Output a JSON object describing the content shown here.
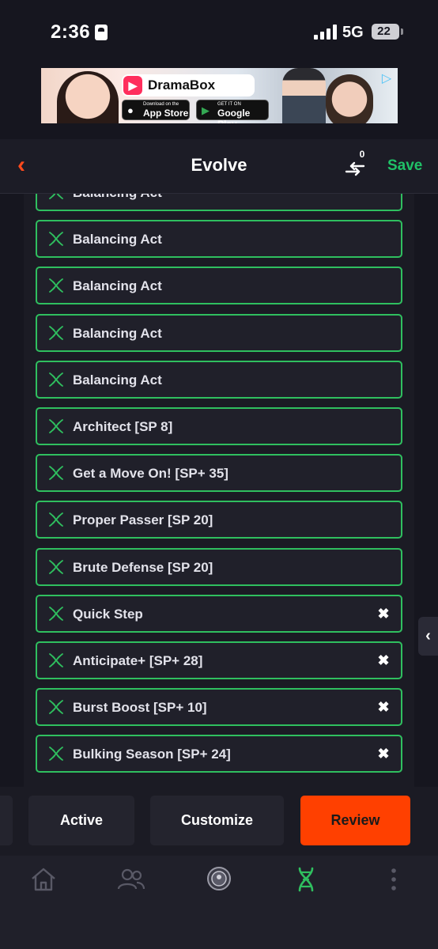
{
  "status_bar": {
    "time": "2:36",
    "network": "5G",
    "battery": "22"
  },
  "ad": {
    "brand": "DramaBox",
    "app_store_small": "Download on the",
    "app_store_big": "App Store",
    "google_play_small": "GET IT ON",
    "google_play_big": "Google Play"
  },
  "header": {
    "title": "Evolve",
    "swap_count": "0",
    "save_label": "Save"
  },
  "traits": [
    {
      "label": "Balancing Act",
      "removable": false
    },
    {
      "label": "Balancing Act",
      "removable": false
    },
    {
      "label": "Balancing Act",
      "removable": false
    },
    {
      "label": "Balancing Act",
      "removable": false
    },
    {
      "label": "Balancing Act",
      "removable": false
    },
    {
      "label": "Architect [SP 8]",
      "removable": false
    },
    {
      "label": "Get a Move On! [SP+ 35]",
      "removable": false
    },
    {
      "label": "Proper Passer [SP 20]",
      "removable": false
    },
    {
      "label": "Brute Defense [SP 20]",
      "removable": false
    },
    {
      "label": "Quick Step",
      "removable": true
    },
    {
      "label": "Anticipate+ [SP+ 28]",
      "removable": true
    },
    {
      "label": "Burst Boost [SP+ 10]",
      "removable": true
    },
    {
      "label": "Bulking Season [SP+ 24]",
      "removable": true
    }
  ],
  "actions": {
    "active": "Active",
    "customize": "Customize",
    "review": "Review"
  },
  "colors": {
    "accent_orange": "#ff4000",
    "accent_green": "#2fbf5f",
    "save_green": "#20c167"
  },
  "tab_bar": [
    {
      "icon": "home-icon"
    },
    {
      "icon": "users-icon"
    },
    {
      "icon": "team-badge-icon"
    },
    {
      "icon": "dna-icon",
      "active": true
    },
    {
      "icon": "more-vertical-icon"
    }
  ]
}
